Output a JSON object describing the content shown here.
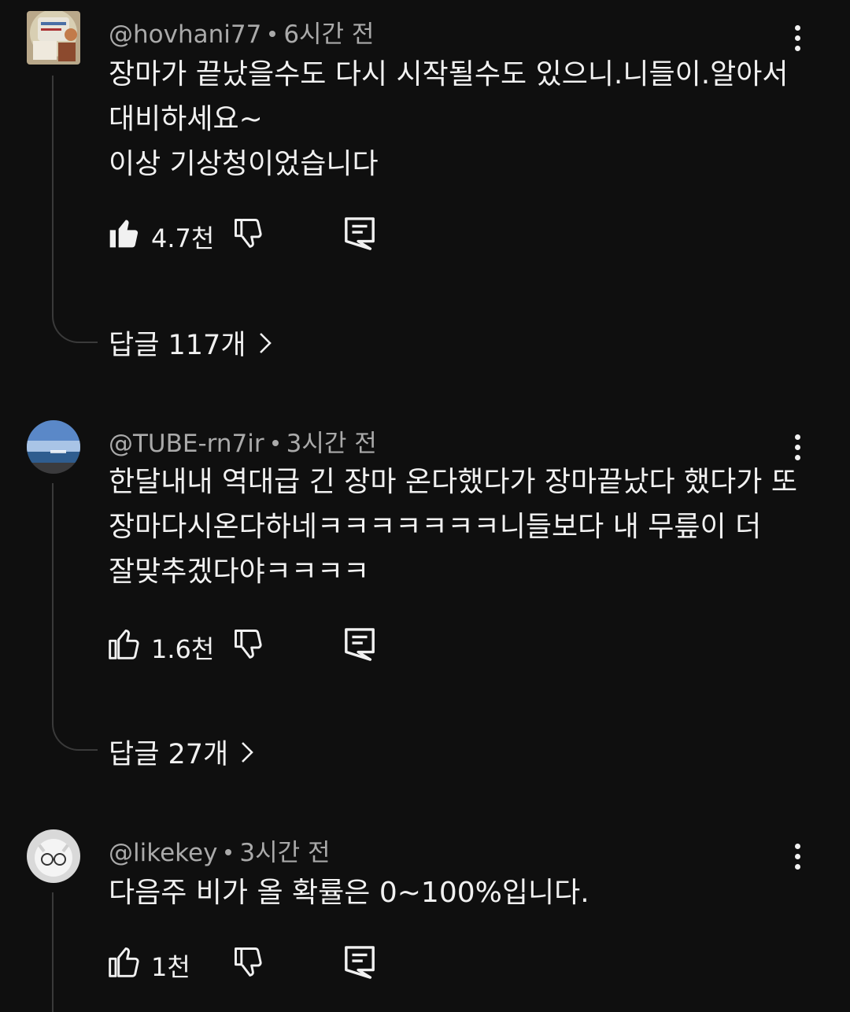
{
  "comments": [
    {
      "author": "@hovhani77",
      "time": "6시간 전",
      "lines": [
        "장마가 끝났을수도 다시 시작될수도 있으니.니들이.알아서",
        "대비하세요~",
        "이상 기상청이었습니다"
      ],
      "likes": "4.7천",
      "liked": true,
      "replies_label": "답글 117개"
    },
    {
      "author": "@TUBE-rn7ir",
      "time": "3시간 전",
      "lines": [
        "한달내내 역대급 긴 장마 온다했다가 장마끝났다 했다가 또",
        "장마다시온다하네ㅋㅋㅋㅋㅋㅋㅋ니들보다 내 무릎이 더",
        "잘맞추겠다야ㅋㅋㅋㅋ"
      ],
      "likes": "1.6천",
      "liked": false,
      "replies_label": "답글 27개"
    },
    {
      "author": "@likekey",
      "time": "3시간 전",
      "lines": [
        "다음주 비가 올 확률은 0~100%입니다."
      ],
      "likes": "1천",
      "liked": false
    }
  ],
  "icons": {
    "like": "thumbs-up-icon",
    "dislike": "thumbs-down-icon",
    "reply": "comment-icon",
    "more": "kebab-menu-icon",
    "expand": "chevron-right-icon"
  },
  "colors": {
    "background": "#0f0f0f",
    "text": "#f1f1f1",
    "secondary": "#aaaaaa"
  }
}
